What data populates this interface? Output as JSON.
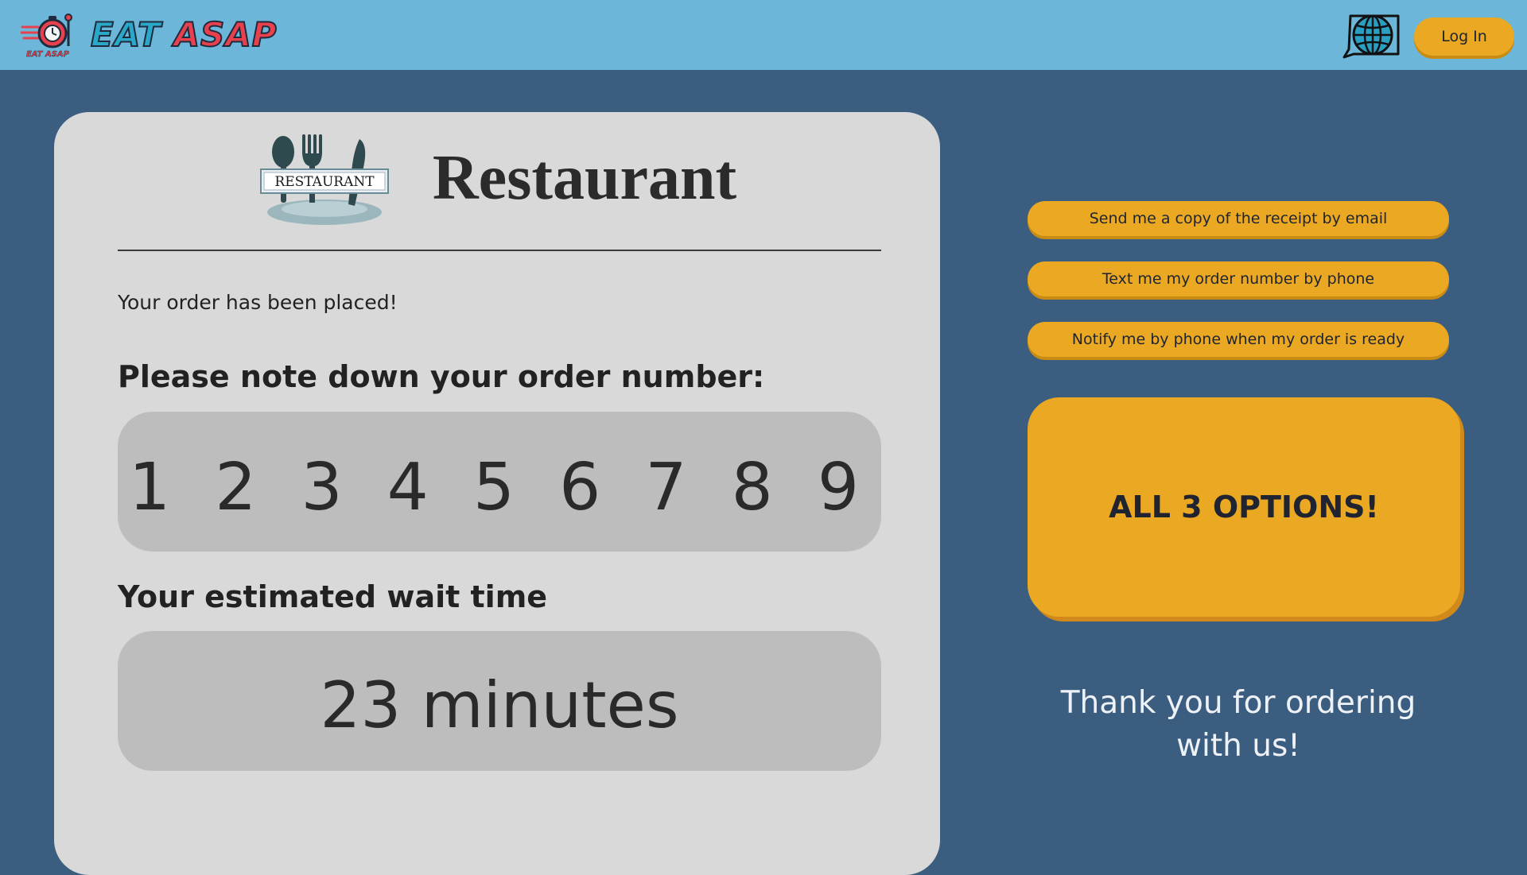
{
  "header": {
    "brand_word_1": "EAT",
    "brand_word_2": "ASAP",
    "brand_mark_text": "EAT ASAP",
    "language_icon": "globe-icon",
    "login_label": "Log In"
  },
  "restaurant": {
    "logo_label": "RESTAURANT",
    "name": "Restaurant"
  },
  "order": {
    "placed_message": "Your order has been placed!",
    "note_label": "Please note down your order number:",
    "number": "1 2 3 4 5 6 7 8 9",
    "wait_label": "Your estimated wait time",
    "wait_value": "23 minutes"
  },
  "options": {
    "email_receipt": "Send me a copy of the receipt by email",
    "text_order_number": "Text me my order number by phone",
    "notify_ready": "Notify me by phone when my order is ready",
    "all_options": "ALL 3 OPTIONS!"
  },
  "footer": {
    "thanks": "Thank you for ordering with us!"
  },
  "colors": {
    "header_bg": "#6cb7d9",
    "page_bg": "#3b5e80",
    "card_bg": "#d9d9d9",
    "box_bg": "#bdbdbd",
    "accent": "#eaa823"
  }
}
